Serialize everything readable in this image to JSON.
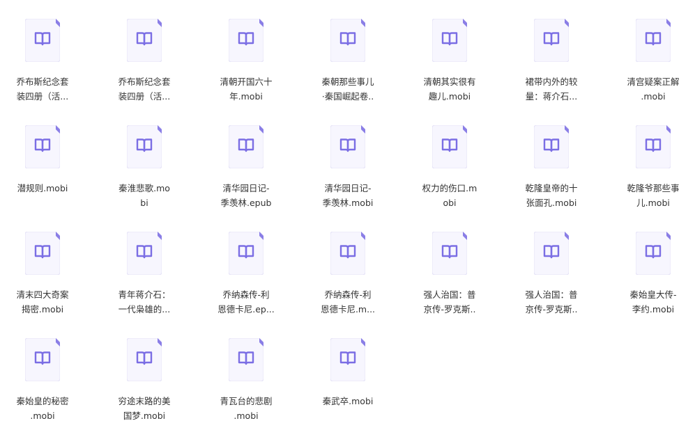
{
  "colors": {
    "page_bg": "#ffffff",
    "doc_bg": "#f7f6fe",
    "doc_border": "#e4e1f6",
    "doc_fold": "#8a7ee6",
    "book_icon": "#7b6ee4",
    "text": "#333333"
  },
  "icon_name": "ebook-file-icon",
  "files": [
    {
      "line1": "乔布斯纪念套",
      "line2": "装四册（活..."
    },
    {
      "line1": "乔布斯纪念套",
      "line2": "装四册（活..."
    },
    {
      "line1": "清朝开国六十",
      "line2": "年.mobi"
    },
    {
      "line1": "秦朝那些事儿",
      "line2": "·秦国崛起卷.."
    },
    {
      "line1": "清朝其实很有",
      "line2": "趣儿.mobi"
    },
    {
      "line1": "裙带内外的较",
      "line2": "量：蒋介石..."
    },
    {
      "line1": "清宫疑案正解",
      "line2": ".mobi"
    },
    {
      "line1": "潜规则.mobi",
      "line2": ""
    },
    {
      "line1": "秦淮悲歌.mo",
      "line2": "bi"
    },
    {
      "line1": "清华园日记-",
      "line2": "季羡林.epub"
    },
    {
      "line1": "清华园日记-",
      "line2": "季羡林.mobi"
    },
    {
      "line1": "权力的伤口.m",
      "line2": "obi"
    },
    {
      "line1": "乾隆皇帝的十",
      "line2": "张面孔.mobi"
    },
    {
      "line1": "乾隆爷那些事",
      "line2": "儿.mobi"
    },
    {
      "line1": "清末四大奇案",
      "line2": "揭密.mobi"
    },
    {
      "line1": "青年蒋介石：",
      "line2": "一代枭雄的..."
    },
    {
      "line1": "乔纳森传-利",
      "line2": "恩德卡尼.ep..."
    },
    {
      "line1": "乔纳森传-利",
      "line2": "恩德卡尼.m..."
    },
    {
      "line1": "强人治国：普",
      "line2": "京传-罗克斯.."
    },
    {
      "line1": "强人治国：普",
      "line2": "京传-罗克斯.."
    },
    {
      "line1": "秦始皇大传-",
      "line2": "李约.mobi"
    },
    {
      "line1": "秦始皇的秘密",
      "line2": ".mobi"
    },
    {
      "line1": "穷途末路的美",
      "line2": "国梦.mobi"
    },
    {
      "line1": "青瓦台的悲剧",
      "line2": ".mobi"
    },
    {
      "line1": "秦武卒.mobi",
      "line2": ""
    }
  ]
}
